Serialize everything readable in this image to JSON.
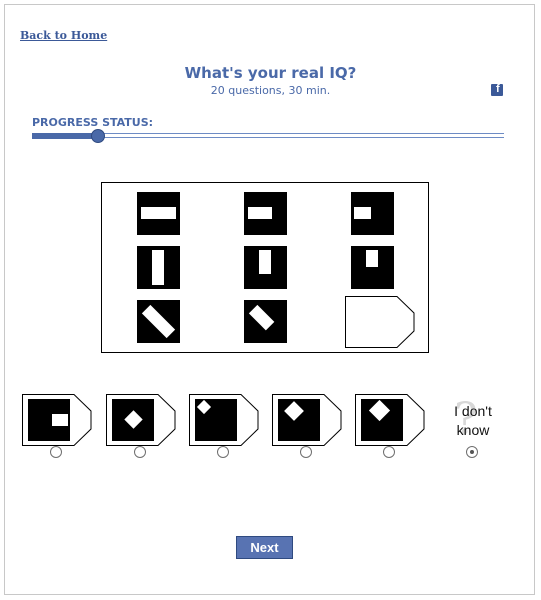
{
  "nav": {
    "back_label": "Back to Home"
  },
  "header": {
    "title": "What's your real IQ?",
    "subtitle": "20 questions, 30 min.",
    "share_icon": "facebook-icon",
    "share_glyph": "f"
  },
  "progress": {
    "label": "PROGRESS STATUS:",
    "fraction": 0.14
  },
  "question": {
    "type": "matrix-puzzle",
    "rows": 3,
    "cols": 3,
    "missing_cell": 9
  },
  "answers": {
    "options": [
      {
        "id": 1,
        "selected": false
      },
      {
        "id": 2,
        "selected": false
      },
      {
        "id": 3,
        "selected": false
      },
      {
        "id": 4,
        "selected": false
      },
      {
        "id": 5,
        "selected": false
      }
    ],
    "dont_know": {
      "line1": "I don't",
      "line2": "know",
      "selected": true
    }
  },
  "actions": {
    "next_label": "Next"
  },
  "colors": {
    "accent": "#4a69a8",
    "button": "#5873b2",
    "facebook": "#3b5998"
  }
}
